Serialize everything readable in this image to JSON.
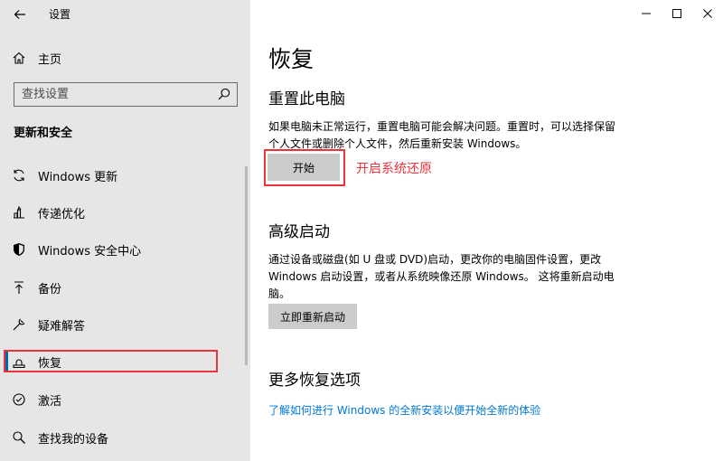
{
  "app": {
    "title": "设置"
  },
  "sidebar": {
    "home_label": "主页",
    "search_placeholder": "查找设置",
    "section_heading": "更新和安全",
    "items": [
      {
        "label": "Windows 更新",
        "icon": "sync-icon"
      },
      {
        "label": "传递优化",
        "icon": "delivery-optimization-icon"
      },
      {
        "label": "Windows 安全中心",
        "icon": "shield-icon"
      },
      {
        "label": "备份",
        "icon": "backup-icon"
      },
      {
        "label": "疑难解答",
        "icon": "wrench-icon"
      },
      {
        "label": "恢复",
        "icon": "recovery-icon",
        "selected": true
      },
      {
        "label": "激活",
        "icon": "activation-icon"
      },
      {
        "label": "查找我的设备",
        "icon": "find-device-icon"
      }
    ]
  },
  "main": {
    "title": "恢复",
    "reset": {
      "heading": "重置此电脑",
      "line1": "如果电脑未正常运行，重置电脑可能会解决问题。重置时，可以选择保留",
      "line2": "个人文件或删除个人文件，然后重新安装 Windows。",
      "button": "开始"
    },
    "annotation": "开启系统还原",
    "advanced": {
      "heading": "高级启动",
      "line1": "通过设备或磁盘(如 U 盘或 DVD)启动，更改你的电脑固件设置，更改",
      "line2": "Windows 启动设置，或者从系统映像还原 Windows。 这将重新启动电",
      "line3": "脑。",
      "button": "立即重新启动"
    },
    "more": {
      "heading": "更多恢复选项",
      "link": "了解如何进行 Windows 的全新安装以便开始全新的体验"
    }
  },
  "colors": {
    "accent": "#0078d7",
    "annotation_red": "#e8343a",
    "sidebar_bg": "#e6e6e6",
    "button_bg": "#cccccc"
  }
}
